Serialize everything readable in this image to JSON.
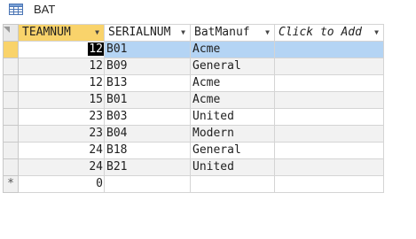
{
  "tab": {
    "title": "BAT",
    "icon": "table-icon"
  },
  "columns": [
    {
      "label": "TEAMNUM",
      "dropdown_icon": "dropdown-arrow-icon"
    },
    {
      "label": "SERIALNUM",
      "dropdown_icon": "dropdown-arrow-icon"
    },
    {
      "label": "BatManuf",
      "dropdown_icon": "dropdown-arrow-icon"
    },
    {
      "label": "Click to Add",
      "dropdown_icon": "dropdown-arrow-icon"
    }
  ],
  "rows": [
    {
      "teamnum": "12",
      "serialnum": "B01",
      "batmanuf": "Acme"
    },
    {
      "teamnum": "12",
      "serialnum": "B09",
      "batmanuf": "General"
    },
    {
      "teamnum": "12",
      "serialnum": "B13",
      "batmanuf": "Acme"
    },
    {
      "teamnum": "15",
      "serialnum": "B01",
      "batmanuf": "Acme"
    },
    {
      "teamnum": "23",
      "serialnum": "B03",
      "batmanuf": "United"
    },
    {
      "teamnum": "23",
      "serialnum": "B04",
      "batmanuf": "Modern"
    },
    {
      "teamnum": "24",
      "serialnum": "B18",
      "batmanuf": "General"
    },
    {
      "teamnum": "24",
      "serialnum": "B21",
      "batmanuf": "United"
    }
  ],
  "new_row": {
    "marker": "*",
    "teamnum": "0"
  },
  "colors": {
    "active_header": "#f9d36b",
    "selected_row": "#b4d4f4",
    "alt_row": "#f2f2f2"
  }
}
